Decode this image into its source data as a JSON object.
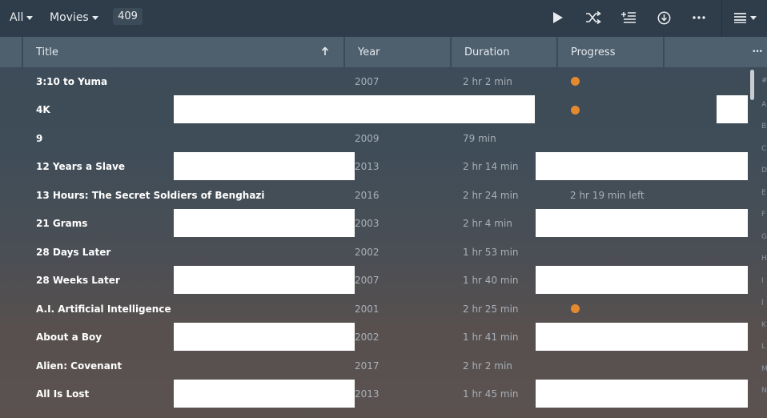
{
  "toolbar": {
    "filter_all": "All",
    "library_type": "Movies",
    "item_count": "409",
    "icons": [
      "play-icon",
      "shuffle-icon",
      "add-to-playlist-icon",
      "download-icon",
      "more-icon",
      "list-view-icon"
    ]
  },
  "columns": {
    "title": "Title",
    "year": "Year",
    "duration": "Duration",
    "progress": "Progress",
    "more": "•••"
  },
  "rows": [
    {
      "title": "3:10 to Yuma",
      "year": "2007",
      "duration": "2 hr 2 min",
      "progress": "",
      "in_progress": true
    },
    {
      "title": "4K",
      "year": "",
      "duration": "",
      "progress": "",
      "in_progress": true
    },
    {
      "title": "9",
      "year": "2009",
      "duration": "79 min",
      "progress": "",
      "in_progress": false
    },
    {
      "title": "12 Years a Slave",
      "year": "2013",
      "duration": "2 hr 14 min",
      "progress": "",
      "in_progress": false
    },
    {
      "title": "13 Hours: The Secret Soldiers of Benghazi",
      "year": "2016",
      "duration": "2 hr 24 min",
      "progress": "2 hr 19 min left",
      "in_progress": false
    },
    {
      "title": "21 Grams",
      "year": "2003",
      "duration": "2 hr 4 min",
      "progress": "",
      "in_progress": false
    },
    {
      "title": "28 Days Later",
      "year": "2002",
      "duration": "1 hr 53 min",
      "progress": "",
      "in_progress": false
    },
    {
      "title": "28 Weeks Later",
      "year": "2007",
      "duration": "1 hr 40 min",
      "progress": "",
      "in_progress": false
    },
    {
      "title": "A.I. Artificial Intelligence",
      "year": "2001",
      "duration": "2 hr 25 min",
      "progress": "",
      "in_progress": true
    },
    {
      "title": "About a Boy",
      "year": "2002",
      "duration": "1 hr 41 min",
      "progress": "",
      "in_progress": false
    },
    {
      "title": "Alien: Covenant",
      "year": "2017",
      "duration": "2 hr 2 min",
      "progress": "",
      "in_progress": false
    },
    {
      "title": "All Is Lost",
      "year": "2013",
      "duration": "1 hr 45 min",
      "progress": "",
      "in_progress": false
    }
  ],
  "colors": {
    "toolbar_bg": "#2f3d4a",
    "header_bg": "#4e5f6d",
    "accent_dot": "#e5892e"
  }
}
